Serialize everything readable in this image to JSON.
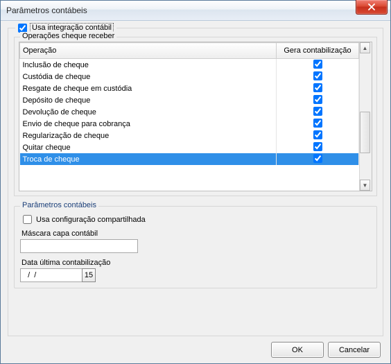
{
  "window": {
    "title": "Parâmetros contábeis",
    "close_icon": "close-icon"
  },
  "outer": {
    "use_integration_label": "Usa integração contábil",
    "use_integration_checked": true
  },
  "grid": {
    "legend": "Operações cheque receber",
    "col_operation": "Operação",
    "col_generate": "Gera contabilização",
    "selected_index": 8,
    "rows": [
      {
        "op": "Inclusão de cheque",
        "gen": true
      },
      {
        "op": "Custódia de cheque",
        "gen": true
      },
      {
        "op": "Resgate de cheque em custódia",
        "gen": true
      },
      {
        "op": "Depósito de cheque",
        "gen": true
      },
      {
        "op": "Devolução de cheque",
        "gen": true
      },
      {
        "op": "Envio de cheque para cobrança",
        "gen": true
      },
      {
        "op": "Regularização de cheque",
        "gen": true
      },
      {
        "op": "Quitar cheque",
        "gen": true
      },
      {
        "op": "Troca de cheque",
        "gen": true
      }
    ]
  },
  "params": {
    "legend": "Parâmetros contábeis",
    "shared_config_label": "Usa configuração compartilhada",
    "shared_config_checked": false,
    "mask_label": "Máscara capa contábil",
    "mask_value": "",
    "date_label": "Data última contabilização",
    "date_value": "  /  /",
    "date_btn_text": "15"
  },
  "buttons": {
    "ok": "OK",
    "cancel": "Cancelar"
  }
}
